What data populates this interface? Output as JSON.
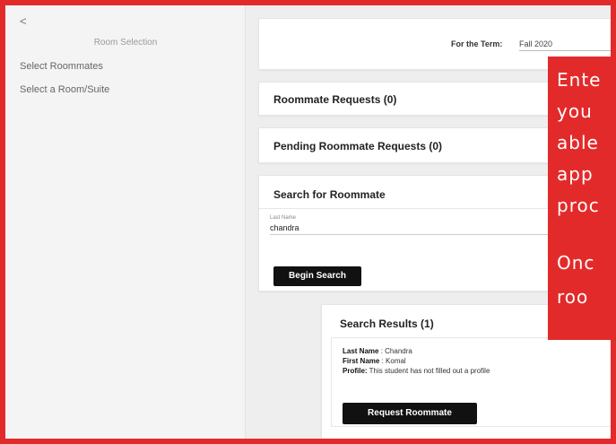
{
  "sidebar": {
    "back_glyph": "<",
    "title": "Room Selection",
    "items": [
      {
        "label": "Select Roommates"
      },
      {
        "label": "Select a Room/Suite"
      }
    ]
  },
  "term": {
    "label": "For the Term:",
    "value": "Fall 2020"
  },
  "sections": {
    "roommate_requests": "Roommate Requests (0)",
    "pending_requests": "Pending Roommate Requests (0)",
    "search_title": "Search for Roommate"
  },
  "search": {
    "last_name_label": "Last Name",
    "last_name_value": "chandra",
    "button_label": "Begin Search"
  },
  "results": {
    "title": "Search Results (1)",
    "last_name_key": "Last Name",
    "last_name_value": " : Chandra",
    "first_name_key": "First Name",
    "first_name_value": " : Komal",
    "profile_key": "Profile:",
    "profile_value": " This student has not filled out a profile",
    "request_button": "Request Roommate"
  },
  "overlay": {
    "lines": [
      "Ente",
      "you",
      "able",
      "app",
      "proc",
      "",
      "Onc",
      "roo"
    ]
  },
  "colors": {
    "accent_red": "#e32a2a",
    "button_black": "#111111"
  }
}
